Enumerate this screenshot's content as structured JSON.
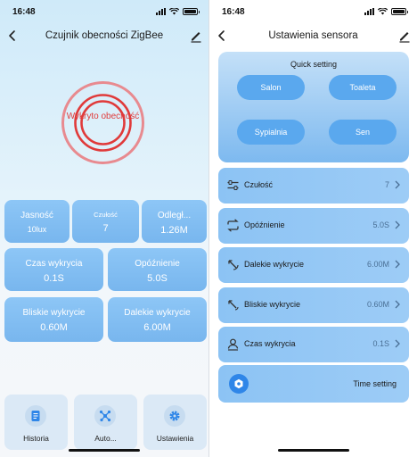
{
  "left": {
    "status": {
      "time": "16:48"
    },
    "title": "Czujnik obecności ZigBee",
    "presence_text": "Wykryto obecność",
    "tiles_top": [
      {
        "label": "Jasność",
        "value": "10lux"
      },
      {
        "label": "Czułość",
        "value": "7"
      },
      {
        "label": "Odległ...",
        "value": "1.26M"
      }
    ],
    "tiles_mid": [
      {
        "label": "Czas wykrycia",
        "value": "0.1S"
      },
      {
        "label": "Opóźnienie",
        "value": "5.0S"
      },
      {
        "label": "Bliskie wykrycie",
        "value": "0.60M"
      },
      {
        "label": "Dalekie wykrycie",
        "value": "6.00M"
      }
    ],
    "bottom": [
      {
        "label": "Historia",
        "icon": "document-icon"
      },
      {
        "label": "Auto...",
        "icon": "nodes-icon"
      },
      {
        "label": "Ustawienia",
        "icon": "gear-icon"
      }
    ]
  },
  "right": {
    "status": {
      "time": "16:48"
    },
    "title": "Ustawienia sensora",
    "quick": {
      "title": "Quick setting",
      "buttons": [
        "Salon",
        "Toaleta",
        "Sypialnia",
        "Sen"
      ]
    },
    "rows": [
      {
        "label": "Czułość",
        "value": "7",
        "icon": "sliders-icon"
      },
      {
        "label": "Opóźnienie",
        "value": "5.0S",
        "icon": "repeat-icon"
      },
      {
        "label": "Dalekie wykrycie",
        "value": "6.00M",
        "icon": "far-detect-icon"
      },
      {
        "label": "Bliskie wykrycie",
        "value": "0.60M",
        "icon": "near-detect-icon"
      },
      {
        "label": "Czas wykrycia",
        "value": "0.1S",
        "icon": "person-icon"
      }
    ],
    "time_setting": "Time setting"
  },
  "colors": {
    "accent": "#5aa8ee",
    "tile": "#78b6ee",
    "alert": "#e03a3a"
  }
}
